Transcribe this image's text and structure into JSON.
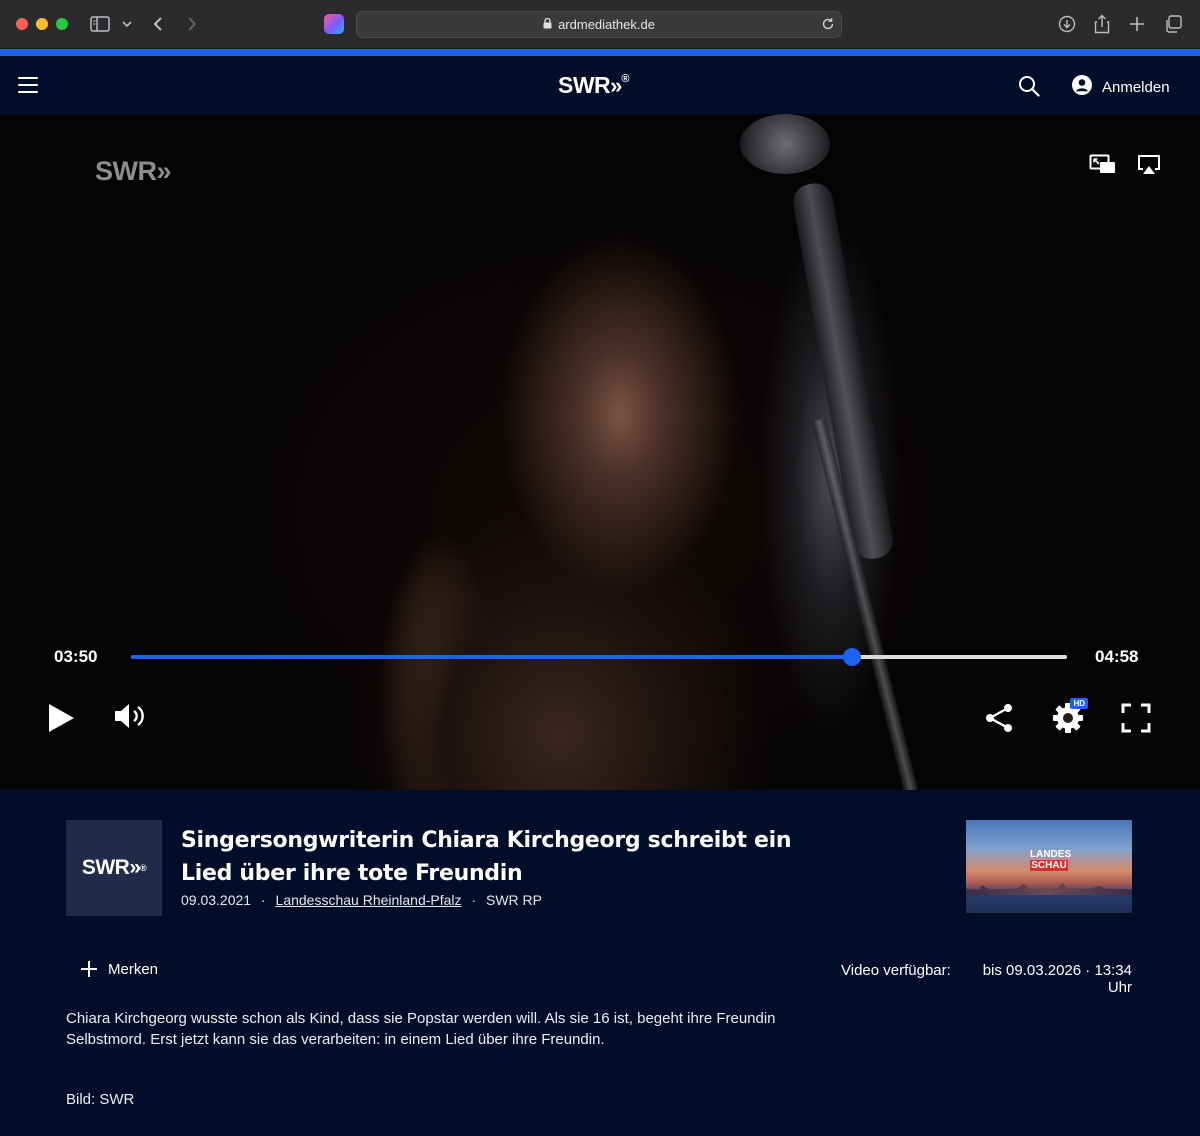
{
  "browser": {
    "url": "ardmediathek.de"
  },
  "header": {
    "logo_text": "SWR",
    "logo_mark": "»",
    "logo_reg": "®",
    "login_label": "Anmelden"
  },
  "player": {
    "watermark_text": "SWR",
    "watermark_mark": "»",
    "current_time": "03:50",
    "total_time": "04:58",
    "progress_fraction": 0.77,
    "hd_badge": "HD",
    "accent_color": "#1d63f0"
  },
  "episode": {
    "channel_logo_text": "SWR",
    "channel_logo_mark": "»",
    "channel_logo_reg": "®",
    "title": "Singersongwriterin Chiara Kirchgeorg schreibt ein Lied über ihre tote Freundin",
    "date": "09.03.2021",
    "sep1": "·",
    "show": "Landesschau Rheinland-Pfalz",
    "sep2": "·",
    "broadcaster": "SWR RP",
    "thumb_brand_line1": "LANDES",
    "thumb_brand_line2": "SCHAU",
    "bookmark_label": "Merken",
    "availability_label": "Video verfügbar:",
    "availability_value": "bis 09.03.2026 · 13:34 Uhr",
    "description": "Chiara Kirchgeorg wusste schon als Kind, dass sie Popstar werden will. Als sie 16 ist, begeht ihre Freundin Selbstmord. Erst jetzt kann sie das verarbeiten: in einem Lied über ihre Freundin.",
    "image_credit": "Bild: SWR"
  }
}
